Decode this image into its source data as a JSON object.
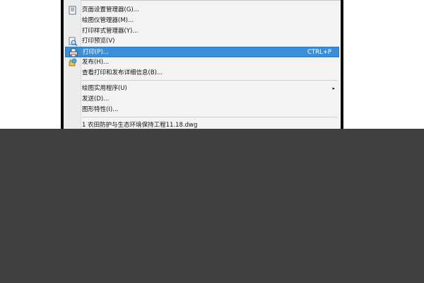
{
  "menu": {
    "items": [
      {
        "label": "页面设置管理器(G)...",
        "icon": "page-setup-icon"
      },
      {
        "label": "绘图仪管理器(M)..."
      },
      {
        "label": "打印样式管理器(Y)..."
      },
      {
        "label": "打印预览(V)",
        "icon": "print-preview-icon"
      },
      {
        "label": "打印(P)...",
        "shortcut": "CTRL+P",
        "icon": "printer-icon",
        "highlighted": true
      },
      {
        "label": "发布(H)...",
        "icon": "publish-icon"
      },
      {
        "label": "查看打印和发布详细信息(B)..."
      },
      {
        "label": "绘图实用程序(U)",
        "submenu_arrow": "▸"
      },
      {
        "label": "发送(D)..."
      },
      {
        "label": "图形特性(I)..."
      },
      {
        "label": "1 农田防护与生态环境保持工程11.18.dwg"
      }
    ]
  },
  "colors": {
    "highlight": "#3a8fd7",
    "desktop": "#3f3f3f"
  }
}
